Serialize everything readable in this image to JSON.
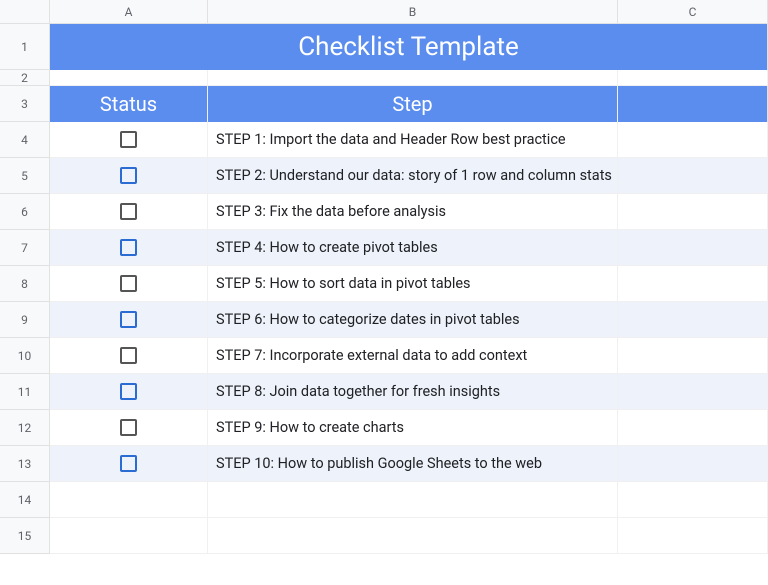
{
  "columns": [
    "A",
    "B",
    "C"
  ],
  "rowNumbers": [
    "1",
    "2",
    "3",
    "4",
    "5",
    "6",
    "7",
    "8",
    "9",
    "10",
    "11",
    "12",
    "13",
    "14",
    "15"
  ],
  "title": "Checklist Template",
  "headers": {
    "status": "Status",
    "step": "Step"
  },
  "steps": [
    "STEP 1: Import the data and Header Row best practice",
    "STEP 2: Understand our data: story of 1 row and column stats",
    "STEP 3: Fix the data before analysis",
    "STEP 4: How to create pivot tables",
    "STEP 5: How to sort data in pivot tables",
    "STEP 6: How to categorize dates in pivot tables",
    "STEP 7: Incorporate external data to add context",
    "STEP 8: Join data together for fresh insights",
    "STEP 9: How to create charts",
    "STEP 10: How to publish Google Sheets to the web"
  ]
}
